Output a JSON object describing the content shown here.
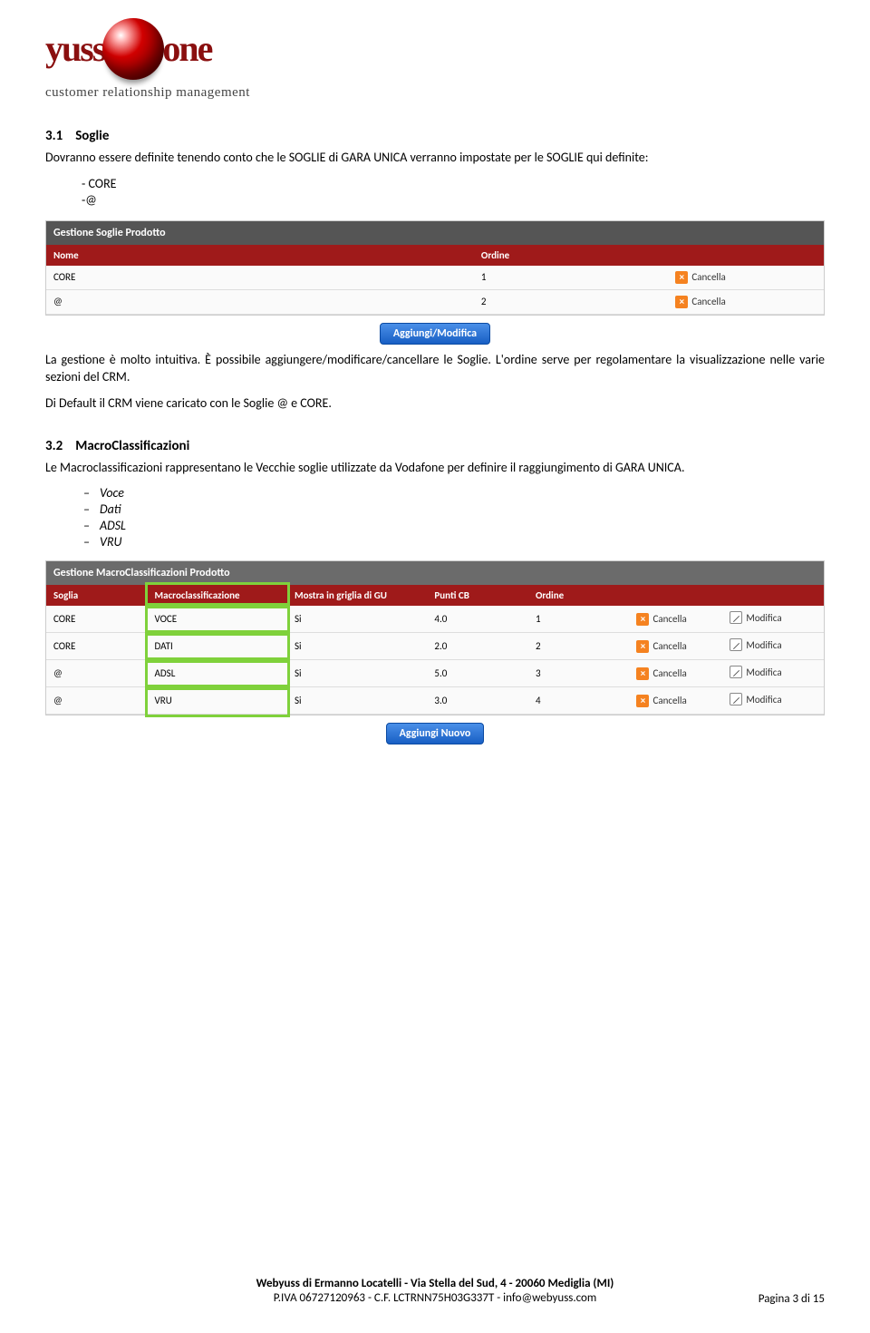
{
  "logo": {
    "text_left": "yuss",
    "text_right": "one",
    "tagline": "customer relationship management"
  },
  "section1": {
    "num": "3.1",
    "title": "Soglie",
    "p1": "Dovranno essere definite tenendo conto che le SOGLIE di GARA UNICA verranno impostate per le SOGLIE qui definite:",
    "list": [
      "- CORE",
      "-@"
    ],
    "p2": "La gestione è molto intuitiva. È possibile aggiungere/modificare/cancellare le Soglie. L'ordine serve per regolamentare la visualizzazione nelle varie sezioni del CRM.",
    "p3": "Di Default il CRM viene caricato con le Soglie @ e CORE."
  },
  "panel1": {
    "title": "Gestione Soglie Prodotto",
    "headers": [
      "Nome",
      "Ordine",
      ""
    ],
    "rows": [
      {
        "nome": "CORE",
        "ordine": "1"
      },
      {
        "nome": "@",
        "ordine": "2"
      }
    ],
    "cancel": "Cancella",
    "button": "Aggiungi/Modifica"
  },
  "section2": {
    "num": "3.2",
    "title": "MacroClassificazioni",
    "p1": "Le Macroclassificazioni rappresentano le Vecchie soglie utilizzate da Vodafone per definire il raggiungimento di GARA UNICA.",
    "list": [
      "Voce",
      "Dati",
      "ADSL",
      "VRU"
    ]
  },
  "panel2": {
    "title": "Gestione MacroClassificazioni Prodotto",
    "headers": [
      "Soglia",
      "Macroclassificazione",
      "Mostra in griglia di GU",
      "Punti CB",
      "Ordine",
      "",
      ""
    ],
    "rows": [
      {
        "soglia": "CORE",
        "macro": "VOCE",
        "mostra": "Si",
        "punti": "4.0",
        "ordine": "1"
      },
      {
        "soglia": "CORE",
        "macro": "DATI",
        "mostra": "Si",
        "punti": "2.0",
        "ordine": "2"
      },
      {
        "soglia": "@",
        "macro": "ADSL",
        "mostra": "Si",
        "punti": "5.0",
        "ordine": "3"
      },
      {
        "soglia": "@",
        "macro": "VRU",
        "mostra": "Si",
        "punti": "3.0",
        "ordine": "4"
      }
    ],
    "cancel": "Cancella",
    "modify": "Modifica",
    "button": "Aggiungi Nuovo"
  },
  "footer": {
    "line1": "Webyuss di Ermanno Locatelli - Via Stella del Sud, 4 - 20060 Mediglia (MI)",
    "line2": "P.IVA 06727120963 - C.F. LCTRNN75H03G337T - info@webyuss.com",
    "page": "Pagina 3 di 15"
  }
}
